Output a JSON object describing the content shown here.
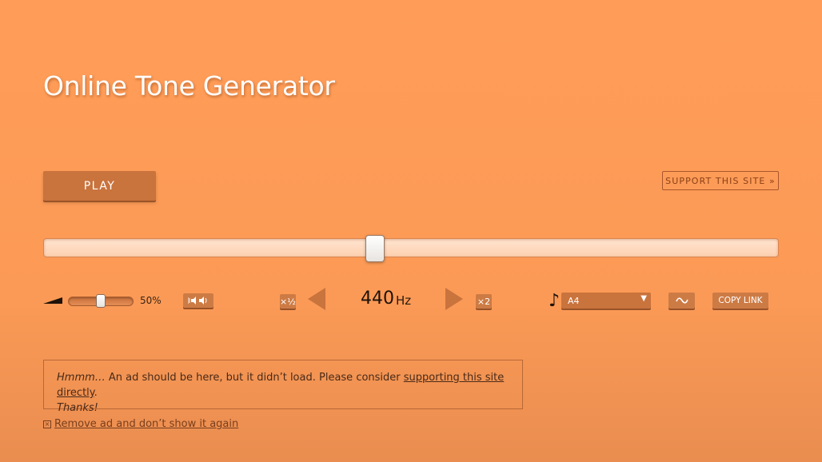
{
  "header": {
    "title": "Online Tone Generator"
  },
  "controls": {
    "play_label": "PLAY",
    "support_label": "SUPPORT THIS SITE »"
  },
  "frequency": {
    "value": "440",
    "unit": "Hz",
    "slider_fraction": 0.45,
    "half_label": "×½",
    "double_label": "×2"
  },
  "volume": {
    "label": "50%",
    "fraction": 0.5
  },
  "note": {
    "selected": "A4"
  },
  "actions": {
    "copy_link_label": "COPY LINK"
  },
  "ad": {
    "hmm": "Hmmm…",
    "message": " An ad should be here, but it didn’t load. Please consider ",
    "link_text": "supporting this site directly",
    "end": ".",
    "thanks": "Thanks!",
    "remove_label": "Remove ad and don’t show it again"
  },
  "colors": {
    "background": "#fb9a56",
    "button": "#c9733d",
    "button_shadow": "#9a5226"
  },
  "icons": {
    "volume": "volume-wedge-icon",
    "speaker": "speaker-toggle-icon",
    "note": "music-note-icon",
    "wave": "sine-wave-icon"
  }
}
